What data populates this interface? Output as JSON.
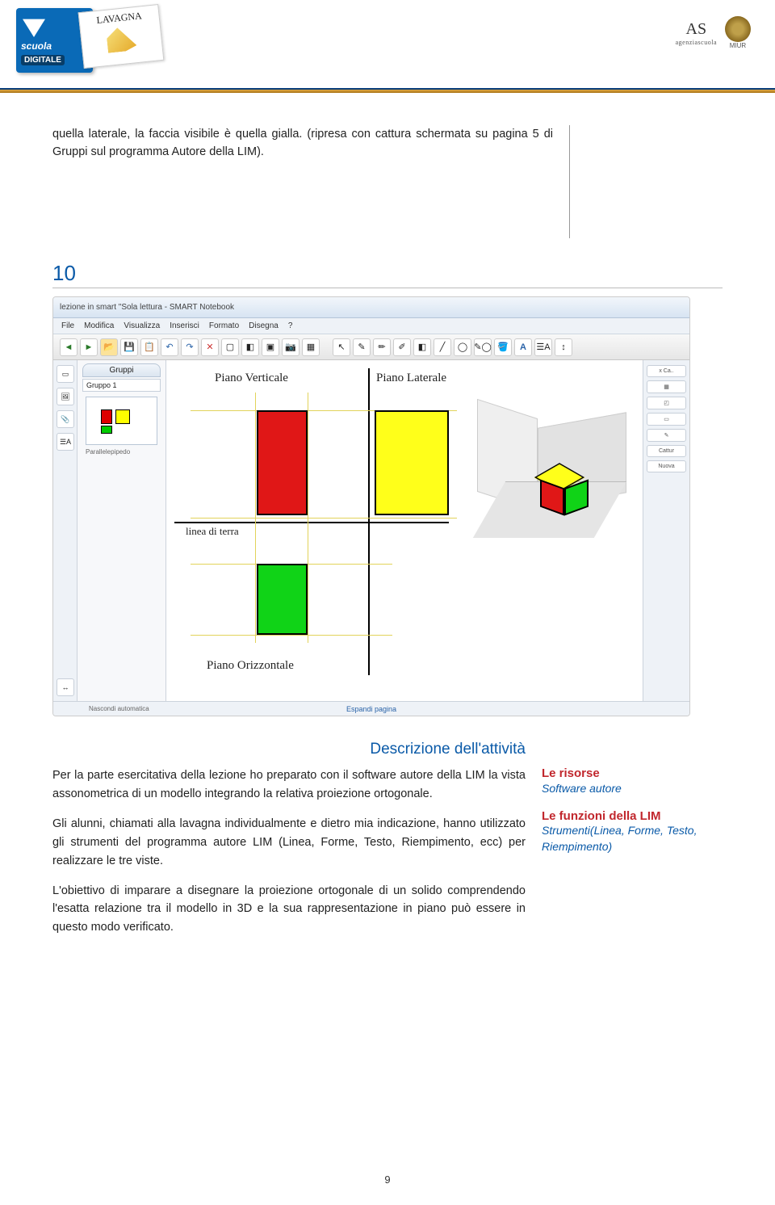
{
  "header": {
    "logo_scuola_top": "scuola",
    "logo_scuola_bottom": "DIGITALE",
    "logo_lavagna": "LAVAGNA",
    "as_monogram": "AS",
    "as_sub": "agenziascuola",
    "miur": "MIUR"
  },
  "top_paragraph": "quella laterale, la faccia visibile è quella gialla. (ripresa con cattura schermata su pagina 5 di Gruppi sul programma Autore della LIM).",
  "figure_number": "10",
  "screenshot": {
    "title": "lezione in smart \"Sola lettura - SMART Notebook",
    "menu": [
      "File",
      "Modifica",
      "Visualizza",
      "Inserisci",
      "Formato",
      "Disegna",
      "?"
    ],
    "group_tab": "Gruppi",
    "group_sub": "Gruppo 1",
    "thumb_label": "Parallelepipedo",
    "labels": {
      "pv": "Piano Verticale",
      "pl": "Piano Laterale",
      "lt": "linea di terra",
      "po": "Piano Orizzontale"
    },
    "right_panel": [
      "x Ca..",
      "Cattur",
      "Nuova"
    ],
    "footer_expand": "Espandi pagina",
    "footer_left": "Nascondi automatica"
  },
  "activity": {
    "title": "Descrizione dell'attività",
    "p1": "Per la parte esercitativa della lezione ho preparato con il software autore della LIM la vista assonometrica di un modello integrando la relativa proiezione ortogonale.",
    "p2": "Gli alunni, chiamati alla lavagna individualmente e dietro mia indicazione, hanno utilizzato gli strumenti del programma autore LIM (Linea, Forme, Testo, Riempimento, ecc) per realizzare le tre viste.",
    "p3": "L'obiettivo di imparare a disegnare la proiezione ortogonale di un solido comprendendo l'esatta relazione tra il modello in 3D e la sua rappresentazione in piano può essere in questo modo verificato."
  },
  "sidebar": {
    "risorse_h": "Le risorse",
    "risorse_t": "Software autore",
    "funzioni_h": "Le funzioni della LIM",
    "funzioni_t": "Strumenti(Linea, Forme, Testo, Riempimento)"
  },
  "page_number": "9"
}
